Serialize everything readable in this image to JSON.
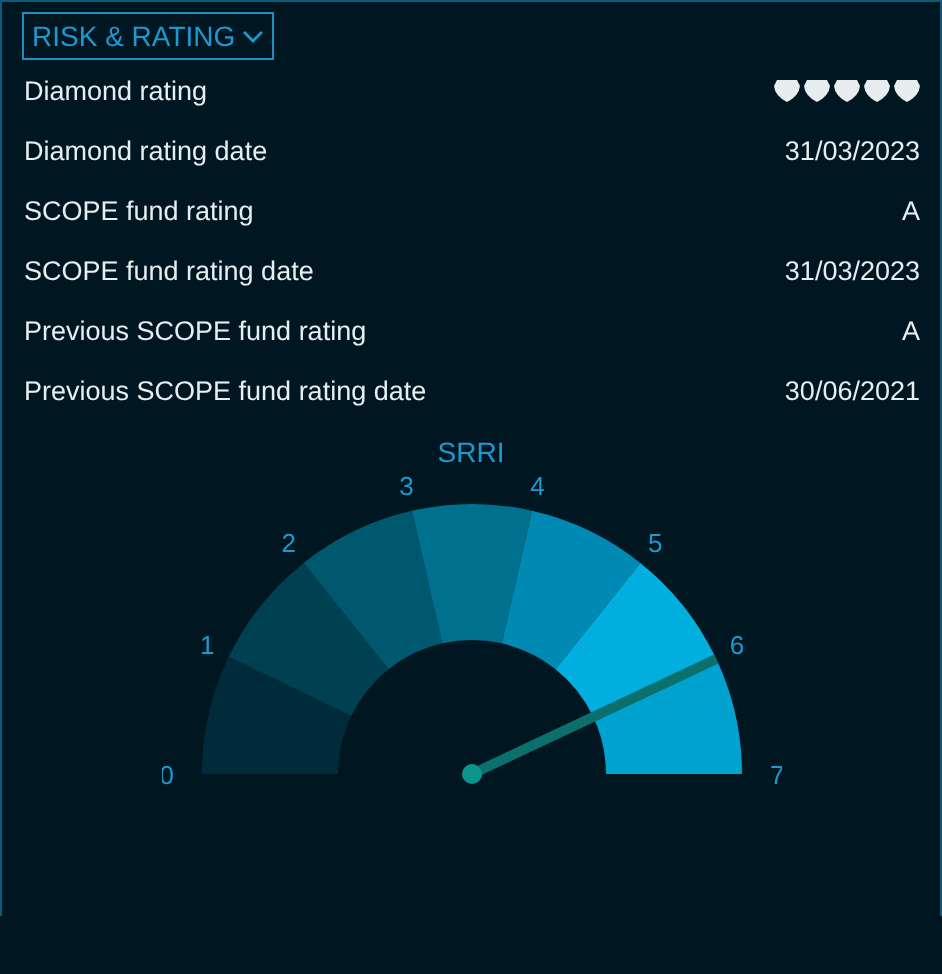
{
  "section": {
    "title": "RISK & RATING",
    "expanded": true
  },
  "rows": [
    {
      "kind": "stars",
      "label": "Diamond rating",
      "stars": 5
    },
    {
      "kind": "text",
      "label": "Diamond rating date",
      "value": "31/03/2023"
    },
    {
      "kind": "text",
      "label": "SCOPE fund rating",
      "value": "A"
    },
    {
      "kind": "text",
      "label": "SCOPE fund rating date",
      "value": "31/03/2023"
    },
    {
      "kind": "text",
      "label": "Previous SCOPE fund rating",
      "value": "A"
    },
    {
      "kind": "text",
      "label": "Previous SCOPE fund rating date",
      "value": "30/06/2021"
    }
  ],
  "gauge": {
    "title": "SRRI",
    "ticks": [
      "0",
      "1",
      "2",
      "3",
      "4",
      "5",
      "6",
      "7"
    ]
  }
}
